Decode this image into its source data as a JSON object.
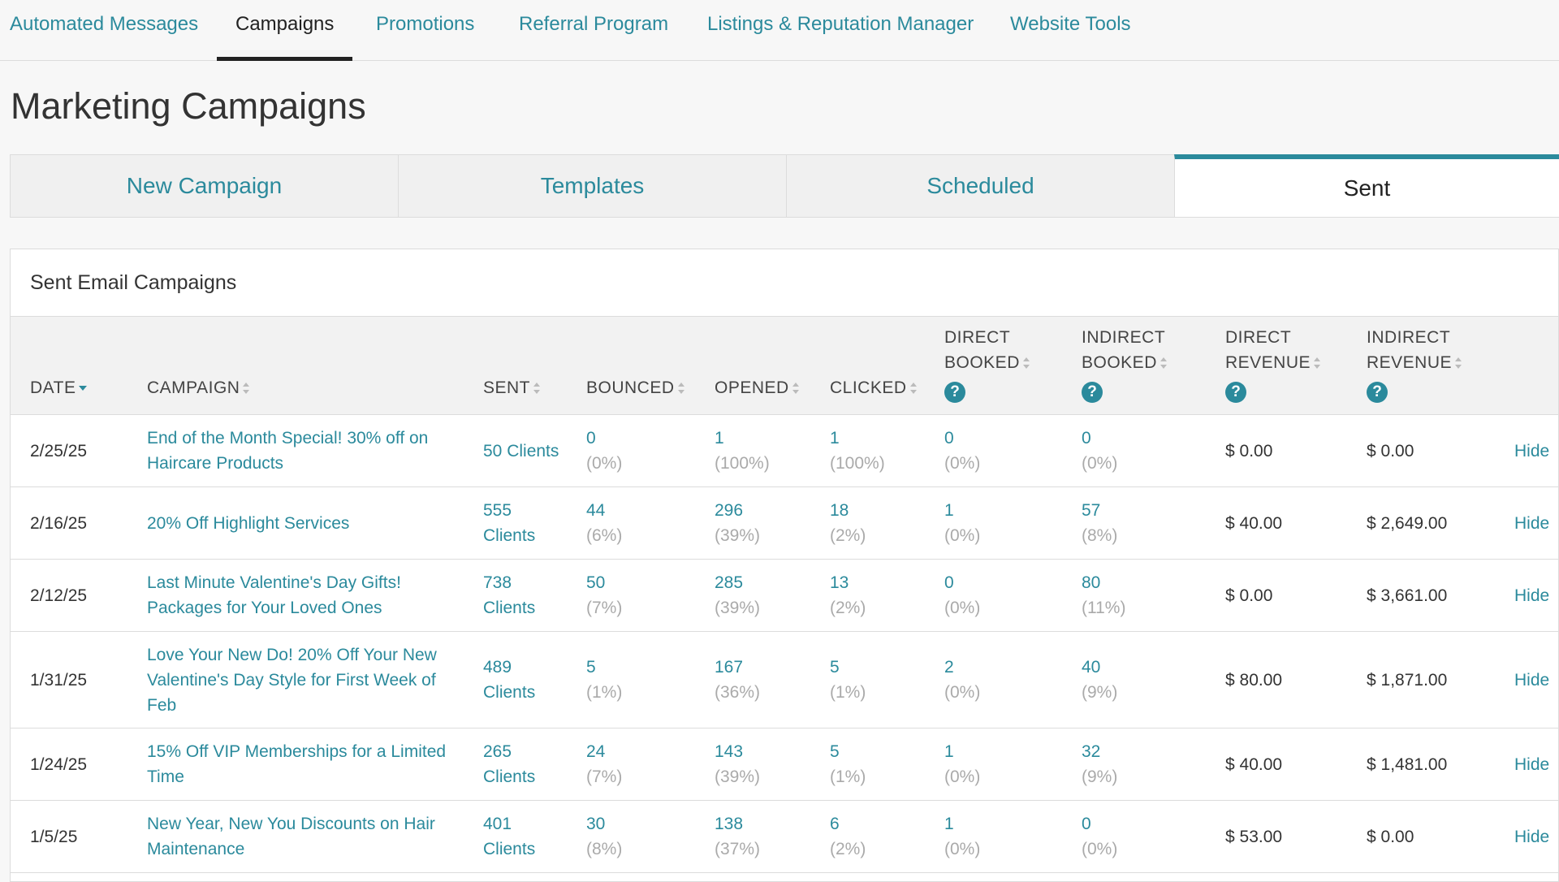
{
  "topnav": {
    "tabs": [
      {
        "label": "Automated Messages"
      },
      {
        "label": "Campaigns"
      },
      {
        "label": "Promotions"
      },
      {
        "label": "Referral Program"
      },
      {
        "label": "Listings & Reputation Manager"
      },
      {
        "label": "Website Tools"
      }
    ],
    "active": "Campaigns"
  },
  "page": {
    "title": "Marketing Campaigns"
  },
  "subtabs": [
    {
      "label": "New Campaign"
    },
    {
      "label": "Templates"
    },
    {
      "label": "Scheduled"
    },
    {
      "label": "Sent"
    }
  ],
  "panel": {
    "title": "Sent Email Campaigns"
  },
  "columns": {
    "date": "DATE",
    "campaign": "CAMPAIGN",
    "sent": "SENT",
    "bounced": "BOUNCED",
    "opened": "OPENED",
    "clicked": "CLICKED",
    "direct_booked_1": "DIRECT",
    "direct_booked_2": "BOOKED",
    "indirect_booked_1": "INDIRECT",
    "indirect_booked_2": "BOOKED",
    "direct_revenue_1": "DIRECT",
    "direct_revenue_2": "REVENUE",
    "indirect_revenue_1": "INDIRECT",
    "indirect_revenue_2": "REVENUE",
    "help_glyph": "?"
  },
  "rows": [
    {
      "date": "2/25/25",
      "campaign_1": "End of the Month Special! 30% off on",
      "campaign_2": "Haircare Products",
      "campaign_3": "",
      "sent_1": "50 Clients",
      "sent_2": "",
      "bounced": "0",
      "bounced_pct": "(0%)",
      "opened": "1",
      "opened_pct": "(100%)",
      "clicked": "1",
      "clicked_pct": "(100%)",
      "direct_booked": "0",
      "direct_booked_pct": "(0%)",
      "indirect_booked": "0",
      "indirect_booked_pct": "(0%)",
      "direct_revenue": "$ 0.00",
      "indirect_revenue": "$ 0.00",
      "action": "Hide"
    },
    {
      "date": "2/16/25",
      "campaign_1": "20% Off Highlight Services",
      "campaign_2": "",
      "campaign_3": "",
      "sent_1": "555",
      "sent_2": "Clients",
      "bounced": "44",
      "bounced_pct": "(6%)",
      "opened": "296",
      "opened_pct": "(39%)",
      "clicked": "18",
      "clicked_pct": "(2%)",
      "direct_booked": "1",
      "direct_booked_pct": "(0%)",
      "indirect_booked": "57",
      "indirect_booked_pct": "(8%)",
      "direct_revenue": "$ 40.00",
      "indirect_revenue": "$ 2,649.00",
      "action": "Hide"
    },
    {
      "date": "2/12/25",
      "campaign_1": "Last Minute Valentine's Day Gifts!",
      "campaign_2": "Packages for Your Loved Ones",
      "campaign_3": "",
      "sent_1": "738",
      "sent_2": "Clients",
      "bounced": "50",
      "bounced_pct": "(7%)",
      "opened": "285",
      "opened_pct": "(39%)",
      "clicked": "13",
      "clicked_pct": "(2%)",
      "direct_booked": "0",
      "direct_booked_pct": "(0%)",
      "indirect_booked": "80",
      "indirect_booked_pct": "(11%)",
      "direct_revenue": "$ 0.00",
      "indirect_revenue": "$ 3,661.00",
      "action": "Hide"
    },
    {
      "date": "1/31/25",
      "campaign_1": "Love Your New Do! 20% Off Your New",
      "campaign_2": "Valentine's Day Style for First Week of",
      "campaign_3": "Feb",
      "sent_1": "489",
      "sent_2": "Clients",
      "bounced": "5",
      "bounced_pct": "(1%)",
      "opened": "167",
      "opened_pct": "(36%)",
      "clicked": "5",
      "clicked_pct": "(1%)",
      "direct_booked": "2",
      "direct_booked_pct": "(0%)",
      "indirect_booked": "40",
      "indirect_booked_pct": "(9%)",
      "direct_revenue": "$ 80.00",
      "indirect_revenue": "$ 1,871.00",
      "action": "Hide"
    },
    {
      "date": "1/24/25",
      "campaign_1": "15% Off VIP Memberships for a Limited",
      "campaign_2": "Time",
      "campaign_3": "",
      "sent_1": "265",
      "sent_2": "Clients",
      "bounced": "24",
      "bounced_pct": "(7%)",
      "opened": "143",
      "opened_pct": "(39%)",
      "clicked": "5",
      "clicked_pct": "(1%)",
      "direct_booked": "1",
      "direct_booked_pct": "(0%)",
      "indirect_booked": "32",
      "indirect_booked_pct": "(9%)",
      "direct_revenue": "$ 40.00",
      "indirect_revenue": "$ 1,481.00",
      "action": "Hide"
    },
    {
      "date": "1/5/25",
      "campaign_1": "New Year, New You Discounts on Hair",
      "campaign_2": "Maintenance",
      "campaign_3": "",
      "sent_1": "401",
      "sent_2": "Clients",
      "bounced": "30",
      "bounced_pct": "(8%)",
      "opened": "138",
      "opened_pct": "(37%)",
      "clicked": "6",
      "clicked_pct": "(2%)",
      "direct_booked": "1",
      "direct_booked_pct": "(0%)",
      "indirect_booked": "0",
      "indirect_booked_pct": "(0%)",
      "direct_revenue": "$ 53.00",
      "indirect_revenue": "$ 0.00",
      "action": "Hide"
    }
  ],
  "colors": {
    "accent": "#2b8a9c",
    "muted": "#aaaaaa"
  }
}
